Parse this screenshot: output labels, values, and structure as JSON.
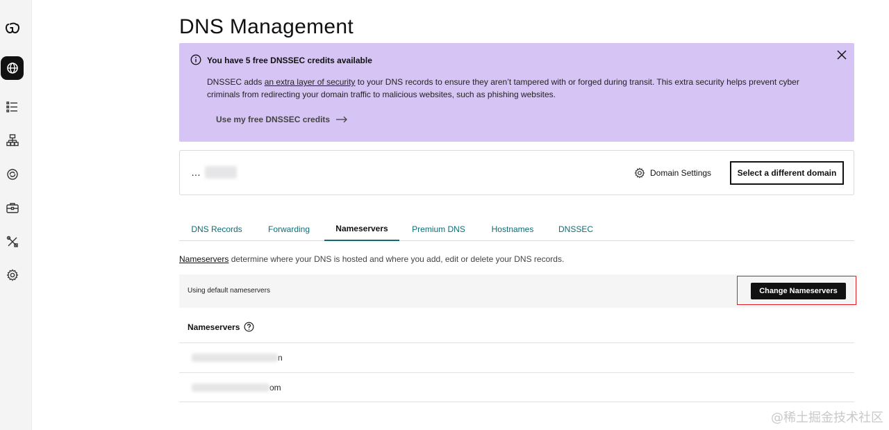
{
  "rail": {
    "items": [
      {
        "icon": "logo-icon",
        "active": false
      },
      {
        "icon": "globe-icon",
        "active": true
      },
      {
        "icon": "list-icon",
        "active": false
      },
      {
        "icon": "sitemap-icon",
        "active": false
      },
      {
        "icon": "refresh-icon",
        "active": false
      },
      {
        "icon": "briefcase-icon",
        "active": false
      },
      {
        "icon": "tools-icon",
        "active": false
      },
      {
        "icon": "gear-icon",
        "active": false
      }
    ]
  },
  "page": {
    "title": "DNS Management"
  },
  "banner": {
    "heading": "You have 5 free DNSSEC credits available",
    "body_prefix": "DNSSEC adds ",
    "body_link": "an extra layer of security",
    "body_suffix": " to your DNS records to ensure they aren’t tampered with or forged during transit. This extra security helps prevent cyber criminals from redirecting your domain traffic to malicious websites, such as phishing websites.",
    "cta": "Use my free DNSSEC credits",
    "bg_color": "#d6c4f4"
  },
  "domain_card": {
    "domain_prefix": "…",
    "settings_label": "Domain Settings",
    "select_label": "Select a different domain"
  },
  "tabs": [
    {
      "label": "DNS Records",
      "active": false
    },
    {
      "label": "Forwarding",
      "active": false
    },
    {
      "label": "Nameservers",
      "active": true
    },
    {
      "label": "Premium DNS",
      "active": false
    },
    {
      "label": "Hostnames",
      "active": false
    },
    {
      "label": "DNSSEC",
      "active": false
    }
  ],
  "nameservers": {
    "desc_link": "Nameservers",
    "desc_text": " determine where your DNS is hosted and where you add, edit or delete your DNS records.",
    "status": "Using default nameservers",
    "change_button": "Change Nameservers",
    "list_header": "Nameservers",
    "entries": [
      "n",
      "om"
    ]
  },
  "watermark": "@稀土掘金技术社区",
  "colors": {
    "accent": "#0b6e76",
    "highlight": "#e01b24",
    "primary_button": "#111111"
  }
}
